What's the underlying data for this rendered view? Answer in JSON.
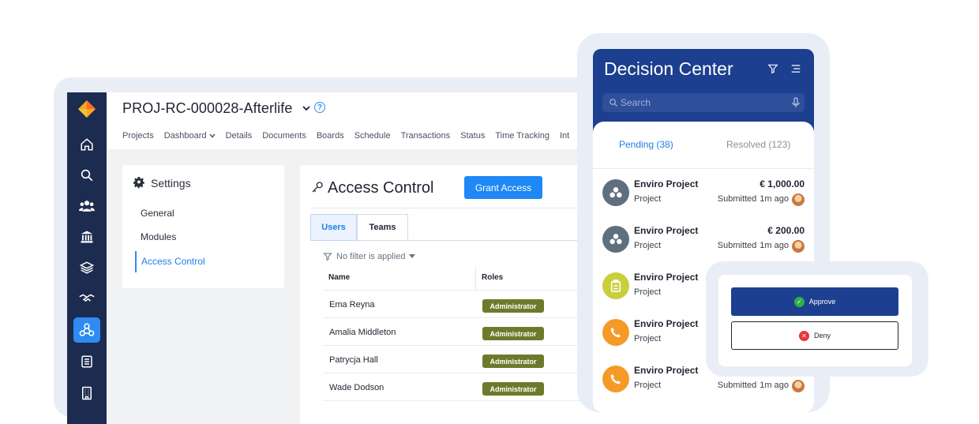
{
  "app": {
    "title": "PROJ-RC-000028-Afterlife",
    "help_glyph": "?",
    "nav": [
      "Projects",
      "Dashboard",
      "Details",
      "Documents",
      "Boards",
      "Schedule",
      "Transactions",
      "Status",
      "Time Tracking",
      "Int"
    ],
    "rail_icons": [
      "home-icon",
      "search-icon",
      "users-icon",
      "bank-icon",
      "layers-icon",
      "handshake-icon",
      "network-icon",
      "list-icon",
      "building-icon"
    ],
    "active_rail_icon": "network-icon",
    "colors": {
      "rail": "#1c2b50",
      "accent": "#2f8bf2",
      "brand": "#f5a623"
    }
  },
  "settings": {
    "title": "Settings",
    "items": [
      {
        "label": "General",
        "active": false
      },
      {
        "label": "Modules",
        "active": false
      },
      {
        "label": "Access Control",
        "active": true
      }
    ]
  },
  "access_control": {
    "title": "Access Control",
    "grant_button": "Grant Access",
    "tabs": [
      {
        "label": "Users",
        "active": true
      },
      {
        "label": "Teams",
        "active": false
      }
    ],
    "filter_text": "No filter is applied",
    "columns": [
      "Name",
      "Roles"
    ],
    "rows": [
      {
        "name": "Ema Reyna",
        "role": "Administrator"
      },
      {
        "name": "Amalia Middleton",
        "role": "Administrator"
      },
      {
        "name": "Patrycja Hall",
        "role": "Administrator"
      },
      {
        "name": "Wade Dodson",
        "role": "Administrator"
      }
    ],
    "role_color": "#6e7a2b"
  },
  "decision_center": {
    "title": "Decision Center",
    "search_placeholder": "Search",
    "tabs": [
      {
        "label": "Pending (38)",
        "active": true
      },
      {
        "label": "Resolved (123)",
        "active": false
      }
    ],
    "items": [
      {
        "name": "Enviro Project",
        "type": "Project",
        "amount": "€ 1,000.00",
        "status": "Submitted",
        "time": "1m ago",
        "icon": "network-icon",
        "icon_color": "#5f6f7e"
      },
      {
        "name": "Enviro Project",
        "type": "Project",
        "amount": "€ 200.00",
        "status": "Submitted",
        "time": "1m ago",
        "icon": "network-icon",
        "icon_color": "#5f6f7e"
      },
      {
        "name": "Enviro Project",
        "type": "Project",
        "amount": "",
        "status": "",
        "time": "",
        "icon": "clipboard-icon",
        "icon_color": "#c9cf3a"
      },
      {
        "name": "Enviro Project",
        "type": "Project",
        "amount": "",
        "status": "",
        "time": "",
        "icon": "phone-icon",
        "icon_color": "#f59a26"
      },
      {
        "name": "Enviro Project",
        "type": "Project",
        "amount": "",
        "status": "Submitted",
        "time": "1m ago",
        "icon": "phone-icon",
        "icon_color": "#f59a26"
      }
    ]
  },
  "popup": {
    "approve": "Approve",
    "deny": "Deny",
    "approve_color": "#1c3f8f"
  }
}
